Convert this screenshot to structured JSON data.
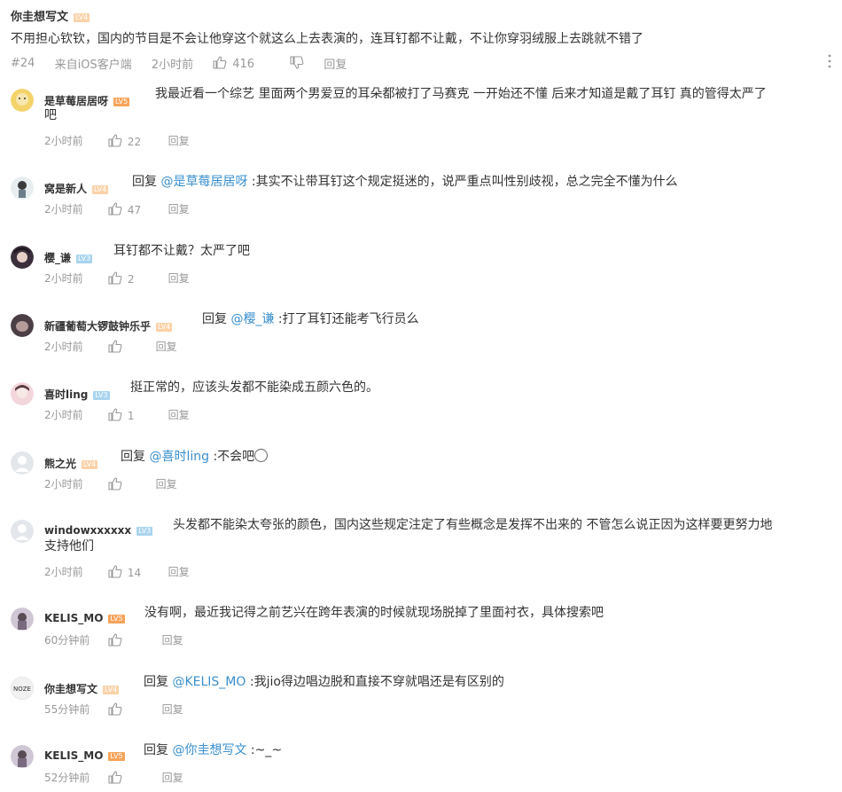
{
  "top_comment": {
    "username": "你圭想写文",
    "level": "LV4",
    "text": "不用担心钦钦，国内的节目是不会让他穿这个就这么上去表演的，连耳钉都不让戴，不让你穿羽绒服上去跳就不错了",
    "floor": "#24",
    "source": "来自iOS客户端",
    "time": "2小时前",
    "likes": "416",
    "reply_label": "回复"
  },
  "replies": [
    {
      "username": "是草莓居居呀",
      "level": "LV5",
      "reply_to": "",
      "text": "我最近看一个综艺 里面两个男爱豆的耳朵都被打了马赛克 一开始还不懂 后来才知道是戴了耳钉 真的管得太严了",
      "text2": "吧",
      "time": "2小时前",
      "likes": "22",
      "reply_label": "回复"
    },
    {
      "username": "窝是新人",
      "level": "LV4",
      "reply_prefix": "回复",
      "reply_to": "@是草莓居居呀",
      "text": " :其实不让带耳钉这个规定挺迷的，说严重点叫性别歧视，总之完全不懂为什么",
      "time": "2小时前",
      "likes": "47",
      "reply_label": "回复"
    },
    {
      "username": "樱_谦",
      "level": "LV3",
      "reply_to": "",
      "text": "耳钉都不让戴？太严了吧",
      "time": "2小时前",
      "likes": "2",
      "reply_label": "回复"
    },
    {
      "username": "新疆葡萄大锣鼓钟乐乎",
      "level": "LV4",
      "reply_prefix": "回复",
      "reply_to": "@樱_谦",
      "text": " :打了耳钉还能考飞行员么",
      "time": "2小时前",
      "likes": "",
      "reply_label": "回复"
    },
    {
      "username": "喜时ling",
      "level": "LV3",
      "reply_to": "",
      "text": "挺正常的，应该头发都不能染成五颜六色的。",
      "time": "2小时前",
      "likes": "1",
      "reply_label": "回复"
    },
    {
      "username": "熊之光",
      "level": "LV4",
      "reply_prefix": "回复",
      "reply_to": "@喜时ling",
      "text": " :不会吧",
      "time": "2小时前",
      "likes": "",
      "reply_label": "回复"
    },
    {
      "username": "windowxxxxxx",
      "level": "LV3",
      "reply_to": "",
      "text": "头发都不能染太夸张的颜色，国内这些规定注定了有些概念是发挥不出来的 不管怎么说正因为这样要更努力地",
      "text2": "支持他们",
      "time": "2小时前",
      "likes": "14",
      "reply_label": "回复"
    },
    {
      "username": "KELIS_MO",
      "level": "LV5",
      "reply_to": "",
      "text": "没有啊，最近我记得之前艺兴在跨年表演的时候就现场脱掉了里面衬衣，具体搜索吧",
      "time": "60分钟前",
      "likes": "",
      "reply_label": "回复"
    },
    {
      "username": "你圭想写文",
      "level": "LV4",
      "reply_prefix": "回复",
      "reply_to": "@KELIS_MO",
      "text": " :我jio得边唱边脱和直接不穿就唱还是有区别的",
      "time": "55分钟前",
      "likes": "",
      "reply_label": "回复"
    },
    {
      "username": "KELIS_MO",
      "level": "LV5",
      "reply_prefix": "回复",
      "reply_to": "@你圭想写文",
      "text": " :~_~",
      "time": "52分钟前",
      "likes": "",
      "reply_label": "回复"
    }
  ],
  "icons": {
    "like": "thumb-up-icon",
    "dislike": "thumb-down-icon",
    "more": "more-vertical-icon"
  },
  "colors": {
    "mention": "#3a8fce",
    "level_orange": "#f7a35a",
    "level_blue": "#a8d4ef",
    "meta": "#999999"
  }
}
